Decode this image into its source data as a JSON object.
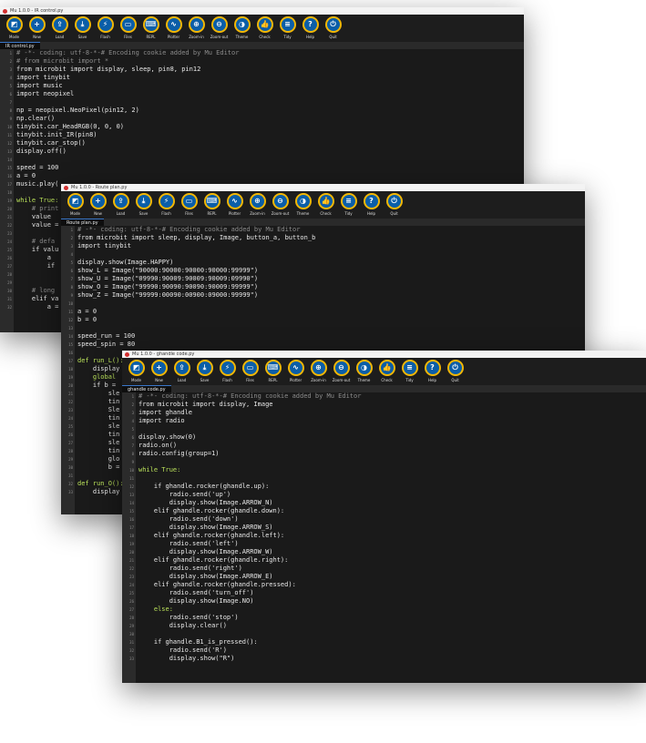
{
  "toolbar_buttons": [
    {
      "label": "Mode",
      "glyph": "◩"
    },
    {
      "label": "New",
      "glyph": "+"
    },
    {
      "label": "Load",
      "glyph": "⇪"
    },
    {
      "label": "Save",
      "glyph": "⤓"
    },
    {
      "label": "Flash",
      "glyph": "⚡"
    },
    {
      "label": "Files",
      "glyph": "▭"
    },
    {
      "label": "REPL",
      "glyph": "⌨"
    },
    {
      "label": "Plotter",
      "glyph": "∿"
    },
    {
      "label": "Zoom-in",
      "glyph": "⊕"
    },
    {
      "label": "Zoom-out",
      "glyph": "⊖"
    },
    {
      "label": "Theme",
      "glyph": "◑"
    },
    {
      "label": "Check",
      "glyph": "👍"
    },
    {
      "label": "Tidy",
      "glyph": "≡"
    },
    {
      "label": "Help",
      "glyph": "?"
    },
    {
      "label": "Quit",
      "glyph": "⏻"
    }
  ],
  "windows": [
    {
      "title": "Mu 1.0.0 - IR control.py",
      "tab": "IR control.py",
      "lines": [
        {
          "n": "1",
          "t": "# -*- coding: utf-8-*-# Encoding cookie added by Mu Editor",
          "c": "cm"
        },
        {
          "n": "2",
          "t": "# from microbit import *",
          "c": "cm"
        },
        {
          "n": "3",
          "t": "from microbit import display, sleep, pin8, pin12",
          "c": ""
        },
        {
          "n": "4",
          "t": "import tinybit",
          "c": ""
        },
        {
          "n": "5",
          "t": "import music",
          "c": ""
        },
        {
          "n": "6",
          "t": "import neopixel",
          "c": ""
        },
        {
          "n": "7",
          "t": "",
          "c": ""
        },
        {
          "n": "8",
          "t": "np = neopixel.NeoPixel(pin12, 2)",
          "c": ""
        },
        {
          "n": "9",
          "t": "np.clear()",
          "c": ""
        },
        {
          "n": "10",
          "t": "tinybit.car_HeadRGB(0, 0, 0)",
          "c": ""
        },
        {
          "n": "11",
          "t": "tinybit.init_IR(pin8)",
          "c": ""
        },
        {
          "n": "12",
          "t": "tinybit.car_stop()",
          "c": ""
        },
        {
          "n": "13",
          "t": "display.off()",
          "c": ""
        },
        {
          "n": "14",
          "t": "",
          "c": ""
        },
        {
          "n": "15",
          "t": "speed = 100",
          "c": ""
        },
        {
          "n": "16",
          "t": "a = 0",
          "c": ""
        },
        {
          "n": "17",
          "t": "music.play(",
          "c": ""
        },
        {
          "n": "18",
          "t": "",
          "c": ""
        },
        {
          "n": "19",
          "t": "while True:",
          "c": "kw"
        },
        {
          "n": "20",
          "t": "    # print",
          "c": "cm"
        },
        {
          "n": "21",
          "t": "    value",
          "c": ""
        },
        {
          "n": "22",
          "t": "    value =",
          "c": ""
        },
        {
          "n": "23",
          "t": "",
          "c": ""
        },
        {
          "n": "24",
          "t": "    # defa",
          "c": "cm"
        },
        {
          "n": "25",
          "t": "    if valu",
          "c": ""
        },
        {
          "n": "26",
          "t": "        a",
          "c": ""
        },
        {
          "n": "27",
          "t": "        if",
          "c": ""
        },
        {
          "n": "28",
          "t": "",
          "c": ""
        },
        {
          "n": "29",
          "t": "",
          "c": ""
        },
        {
          "n": "30",
          "t": "    # long",
          "c": "cm"
        },
        {
          "n": "31",
          "t": "    elif va",
          "c": ""
        },
        {
          "n": "32",
          "t": "        a =",
          "c": ""
        }
      ]
    },
    {
      "title": "Mu 1.0.0 - Route plan.py",
      "tab": "Route plan.py",
      "lines": [
        {
          "n": "1",
          "t": "# -*- coding: utf-8-*-# Encoding cookie added by Mu Editor",
          "c": "cm"
        },
        {
          "n": "2",
          "t": "from microbit import sleep, display, Image, button_a, button_b",
          "c": ""
        },
        {
          "n": "3",
          "t": "import tinybit",
          "c": ""
        },
        {
          "n": "4",
          "t": "",
          "c": ""
        },
        {
          "n": "5",
          "t": "display.show(Image.HAPPY)",
          "c": ""
        },
        {
          "n": "6",
          "t": "show_L = Image(\"90000:90000:90000:90000:99999\")",
          "c": ""
        },
        {
          "n": "7",
          "t": "show_U = Image(\"09990:90009:90009:90009:09990\")",
          "c": ""
        },
        {
          "n": "8",
          "t": "show_O = Image(\"99990:90090:90090:90009:99999\")",
          "c": ""
        },
        {
          "n": "9",
          "t": "show_Z = Image(\"99999:00090:00900:09000:99999\")",
          "c": ""
        },
        {
          "n": "10",
          "t": "",
          "c": ""
        },
        {
          "n": "11",
          "t": "a = 0",
          "c": ""
        },
        {
          "n": "12",
          "t": "b = 0",
          "c": ""
        },
        {
          "n": "13",
          "t": "",
          "c": ""
        },
        {
          "n": "14",
          "t": "speed_run = 100",
          "c": ""
        },
        {
          "n": "15",
          "t": "speed_spin = 80",
          "c": ""
        },
        {
          "n": "16",
          "t": "",
          "c": ""
        },
        {
          "n": "17",
          "t": "def run_L():",
          "c": "kw"
        },
        {
          "n": "18",
          "t": "    display",
          "c": ""
        },
        {
          "n": "19",
          "t": "    global",
          "c": "kw"
        },
        {
          "n": "20",
          "t": "    if b =",
          "c": ""
        },
        {
          "n": "21",
          "t": "        sle",
          "c": ""
        },
        {
          "n": "22",
          "t": "        tin",
          "c": ""
        },
        {
          "n": "23",
          "t": "        Sle",
          "c": ""
        },
        {
          "n": "24",
          "t": "        tin",
          "c": ""
        },
        {
          "n": "25",
          "t": "        sle",
          "c": ""
        },
        {
          "n": "26",
          "t": "        tin",
          "c": ""
        },
        {
          "n": "27",
          "t": "        sle",
          "c": ""
        },
        {
          "n": "28",
          "t": "        tin",
          "c": ""
        },
        {
          "n": "29",
          "t": "        glo",
          "c": ""
        },
        {
          "n": "30",
          "t": "        b =",
          "c": ""
        },
        {
          "n": "31",
          "t": "",
          "c": ""
        },
        {
          "n": "32",
          "t": "def run_O():",
          "c": "kw"
        },
        {
          "n": "33",
          "t": "    display",
          "c": ""
        }
      ]
    },
    {
      "title": "Mu 1.0.0 - ghandle code.py",
      "tab": "ghandle code.py",
      "lines": [
        {
          "n": "1",
          "t": "# -*- coding: utf-8-*-# Encoding cookie added by Mu Editor",
          "c": "cm"
        },
        {
          "n": "2",
          "t": "from microbit import display, Image",
          "c": ""
        },
        {
          "n": "3",
          "t": "import ghandle",
          "c": ""
        },
        {
          "n": "4",
          "t": "import radio",
          "c": ""
        },
        {
          "n": "5",
          "t": "",
          "c": ""
        },
        {
          "n": "6",
          "t": "display.show(0)",
          "c": ""
        },
        {
          "n": "7",
          "t": "radio.on()",
          "c": ""
        },
        {
          "n": "8",
          "t": "radio.config(group=1)",
          "c": ""
        },
        {
          "n": "9",
          "t": "",
          "c": ""
        },
        {
          "n": "10",
          "t": "while True:",
          "c": "kw"
        },
        {
          "n": "11",
          "t": "",
          "c": ""
        },
        {
          "n": "12",
          "t": "    if ghandle.rocker(ghandle.up):",
          "c": ""
        },
        {
          "n": "13",
          "t": "        radio.send('up')",
          "c": ""
        },
        {
          "n": "14",
          "t": "        display.show(Image.ARROW_N)",
          "c": ""
        },
        {
          "n": "15",
          "t": "    elif ghandle.rocker(ghandle.down):",
          "c": ""
        },
        {
          "n": "16",
          "t": "        radio.send('down')",
          "c": ""
        },
        {
          "n": "17",
          "t": "        display.show(Image.ARROW_S)",
          "c": ""
        },
        {
          "n": "18",
          "t": "    elif ghandle.rocker(ghandle.left):",
          "c": ""
        },
        {
          "n": "19",
          "t": "        radio.send('left')",
          "c": ""
        },
        {
          "n": "20",
          "t": "        display.show(Image.ARROW_W)",
          "c": ""
        },
        {
          "n": "21",
          "t": "    elif ghandle.rocker(ghandle.right):",
          "c": ""
        },
        {
          "n": "22",
          "t": "        radio.send('right')",
          "c": ""
        },
        {
          "n": "23",
          "t": "        display.show(Image.ARROW_E)",
          "c": ""
        },
        {
          "n": "24",
          "t": "    elif ghandle.rocker(ghandle.pressed):",
          "c": ""
        },
        {
          "n": "25",
          "t": "        radio.send('turn_off')",
          "c": ""
        },
        {
          "n": "26",
          "t": "        display.show(Image.NO)",
          "c": ""
        },
        {
          "n": "27",
          "t": "    else:",
          "c": "kw"
        },
        {
          "n": "28",
          "t": "        radio.send('stop')",
          "c": ""
        },
        {
          "n": "29",
          "t": "        display.clear()",
          "c": ""
        },
        {
          "n": "30",
          "t": "",
          "c": ""
        },
        {
          "n": "31",
          "t": "    if ghandle.B1_is_pressed():",
          "c": ""
        },
        {
          "n": "32",
          "t": "        radio.send('R')",
          "c": ""
        },
        {
          "n": "33",
          "t": "        display.show(\"R\")",
          "c": ""
        }
      ]
    }
  ]
}
